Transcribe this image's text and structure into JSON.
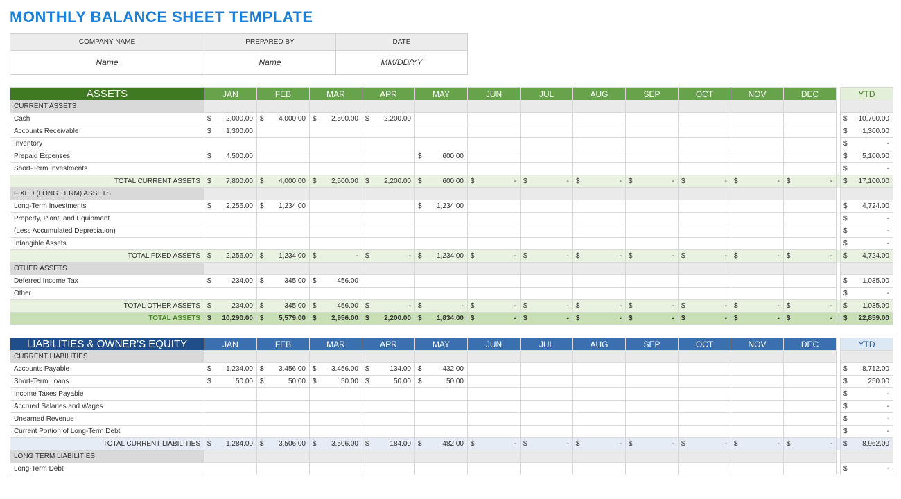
{
  "title": "MONTHLY BALANCE SHEET TEMPLATE",
  "meta": {
    "headers": [
      "COMPANY NAME",
      "PREPARED BY",
      "DATE"
    ],
    "values": [
      "Name",
      "Name",
      "MM/DD/YY"
    ]
  },
  "months": [
    "JAN",
    "FEB",
    "MAR",
    "APR",
    "MAY",
    "JUN",
    "JUL",
    "AUG",
    "SEP",
    "OCT",
    "NOV",
    "DEC"
  ],
  "ytd_label": "YTD",
  "assets": {
    "heading": "ASSETS",
    "groups": [
      {
        "label": "CURRENT ASSETS",
        "rows": [
          {
            "label": "Cash",
            "vals": [
              2000,
              4000,
              2500,
              2200,
              null,
              null,
              null,
              null,
              null,
              null,
              null,
              null
            ],
            "ytd": 10700
          },
          {
            "label": "Accounts Receivable",
            "vals": [
              1300,
              null,
              null,
              null,
              null,
              null,
              null,
              null,
              null,
              null,
              null,
              null
            ],
            "ytd": 1300
          },
          {
            "label": "Inventory",
            "vals": [
              null,
              null,
              null,
              null,
              null,
              null,
              null,
              null,
              null,
              null,
              null,
              null
            ],
            "ytd": 0
          },
          {
            "label": "Prepaid Expenses",
            "vals": [
              4500,
              null,
              null,
              null,
              600,
              null,
              null,
              null,
              null,
              null,
              null,
              null
            ],
            "ytd": 5100
          },
          {
            "label": "Short-Term Investments",
            "vals": [
              null,
              null,
              null,
              null,
              null,
              null,
              null,
              null,
              null,
              null,
              null,
              null
            ],
            "ytd": 0
          }
        ],
        "total": {
          "label": "TOTAL CURRENT ASSETS",
          "vals": [
            7800,
            4000,
            2500,
            2200,
            600,
            0,
            0,
            0,
            0,
            0,
            0,
            0
          ],
          "ytd": 17100
        }
      },
      {
        "label": "FIXED (LONG TERM) ASSETS",
        "rows": [
          {
            "label": "Long-Term Investments",
            "vals": [
              2256,
              1234,
              null,
              null,
              1234,
              null,
              null,
              null,
              null,
              null,
              null,
              null
            ],
            "ytd": 4724
          },
          {
            "label": "Property, Plant, and Equipment",
            "vals": [
              null,
              null,
              null,
              null,
              null,
              null,
              null,
              null,
              null,
              null,
              null,
              null
            ],
            "ytd": 0
          },
          {
            "label": "(Less Accumulated Depreciation)",
            "vals": [
              null,
              null,
              null,
              null,
              null,
              null,
              null,
              null,
              null,
              null,
              null,
              null
            ],
            "ytd": 0
          },
          {
            "label": "Intangible Assets",
            "vals": [
              null,
              null,
              null,
              null,
              null,
              null,
              null,
              null,
              null,
              null,
              null,
              null
            ],
            "ytd": 0
          }
        ],
        "total": {
          "label": "TOTAL FIXED ASSETS",
          "vals": [
            2256,
            1234,
            0,
            0,
            1234,
            0,
            0,
            0,
            0,
            0,
            0,
            0
          ],
          "ytd": 4724
        }
      },
      {
        "label": "OTHER ASSETS",
        "rows": [
          {
            "label": "Deferred Income Tax",
            "vals": [
              234,
              345,
              456,
              null,
              null,
              null,
              null,
              null,
              null,
              null,
              null,
              null
            ],
            "ytd": 1035
          },
          {
            "label": "Other",
            "vals": [
              null,
              null,
              null,
              null,
              null,
              null,
              null,
              null,
              null,
              null,
              null,
              null
            ],
            "ytd": 0
          }
        ],
        "total": {
          "label": "TOTAL OTHER ASSETS",
          "vals": [
            234,
            345,
            456,
            0,
            0,
            0,
            0,
            0,
            0,
            0,
            0,
            0
          ],
          "ytd": 1035
        }
      }
    ],
    "grand": {
      "label": "TOTAL ASSETS",
      "vals": [
        10290,
        5579,
        2956,
        2200,
        1834,
        0,
        0,
        0,
        0,
        0,
        0,
        0
      ],
      "ytd": 22859
    }
  },
  "liabilities": {
    "heading": "LIABILITIES & OWNER'S EQUITY",
    "groups": [
      {
        "label": "CURRENT LIABILITIES",
        "rows": [
          {
            "label": "Accounts Payable",
            "vals": [
              1234,
              3456,
              3456,
              134,
              432,
              null,
              null,
              null,
              null,
              null,
              null,
              null
            ],
            "ytd": 8712
          },
          {
            "label": "Short-Term Loans",
            "vals": [
              50,
              50,
              50,
              50,
              50,
              null,
              null,
              null,
              null,
              null,
              null,
              null
            ],
            "ytd": 250
          },
          {
            "label": "Income Taxes Payable",
            "vals": [
              null,
              null,
              null,
              null,
              null,
              null,
              null,
              null,
              null,
              null,
              null,
              null
            ],
            "ytd": 0
          },
          {
            "label": "Accrued Salaries and Wages",
            "vals": [
              null,
              null,
              null,
              null,
              null,
              null,
              null,
              null,
              null,
              null,
              null,
              null
            ],
            "ytd": 0
          },
          {
            "label": "Unearned Revenue",
            "vals": [
              null,
              null,
              null,
              null,
              null,
              null,
              null,
              null,
              null,
              null,
              null,
              null
            ],
            "ytd": 0
          },
          {
            "label": "Current Portion of Long-Term Debt",
            "vals": [
              null,
              null,
              null,
              null,
              null,
              null,
              null,
              null,
              null,
              null,
              null,
              null
            ],
            "ytd": 0
          }
        ],
        "total": {
          "label": "TOTAL CURRENT LIABILITIES",
          "vals": [
            1284,
            3506,
            3506,
            184,
            482,
            0,
            0,
            0,
            0,
            0,
            0,
            0
          ],
          "ytd": 8962
        }
      },
      {
        "label": "LONG TERM LIABILITIES",
        "rows": [
          {
            "label": "Long-Term Debt",
            "vals": [
              null,
              null,
              null,
              null,
              null,
              null,
              null,
              null,
              null,
              null,
              null,
              null
            ],
            "ytd": null
          }
        ],
        "total": null
      }
    ],
    "grand": null
  }
}
